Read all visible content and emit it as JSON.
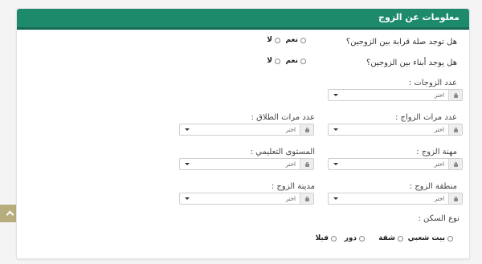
{
  "panel": {
    "title": "معلومات عن الزوج"
  },
  "kinship_q": {
    "text": "هل توجد صلة قرابة بين الزوجين؟",
    "yes": "نعم",
    "no": "لا"
  },
  "children_q": {
    "text": "هل يوجد أبناء بين الزوجين؟",
    "yes": "نعم",
    "no": "لا"
  },
  "fields": {
    "wives_count": {
      "label": "عدد الزوجات :",
      "value": "اختر"
    },
    "marriages_count": {
      "label": "عدد مرات الزواج :",
      "value": "اختر"
    },
    "divorces_count": {
      "label": "عدد مرات الطلاق :",
      "value": "اختر"
    },
    "occupation": {
      "label": "مهنة الزوج :",
      "value": "اختر"
    },
    "education": {
      "label": "المستوى التعليمي :",
      "value": "اختر"
    },
    "region": {
      "label": "منطقة الزوج :",
      "value": "اختر"
    },
    "city": {
      "label": "مدينة الزوج :",
      "value": "اختر"
    }
  },
  "housing": {
    "label": "نوع السكن :",
    "options": [
      "بيت شعبي",
      "شقة",
      "دور",
      "فيلا"
    ]
  },
  "icons": {
    "lock": "lock-icon",
    "caret": "caret-down-icon",
    "scroll_top": "chevron-up-icon"
  },
  "colors": {
    "header": "#1d8a6c",
    "scroll_button": "#b7ad7c"
  }
}
